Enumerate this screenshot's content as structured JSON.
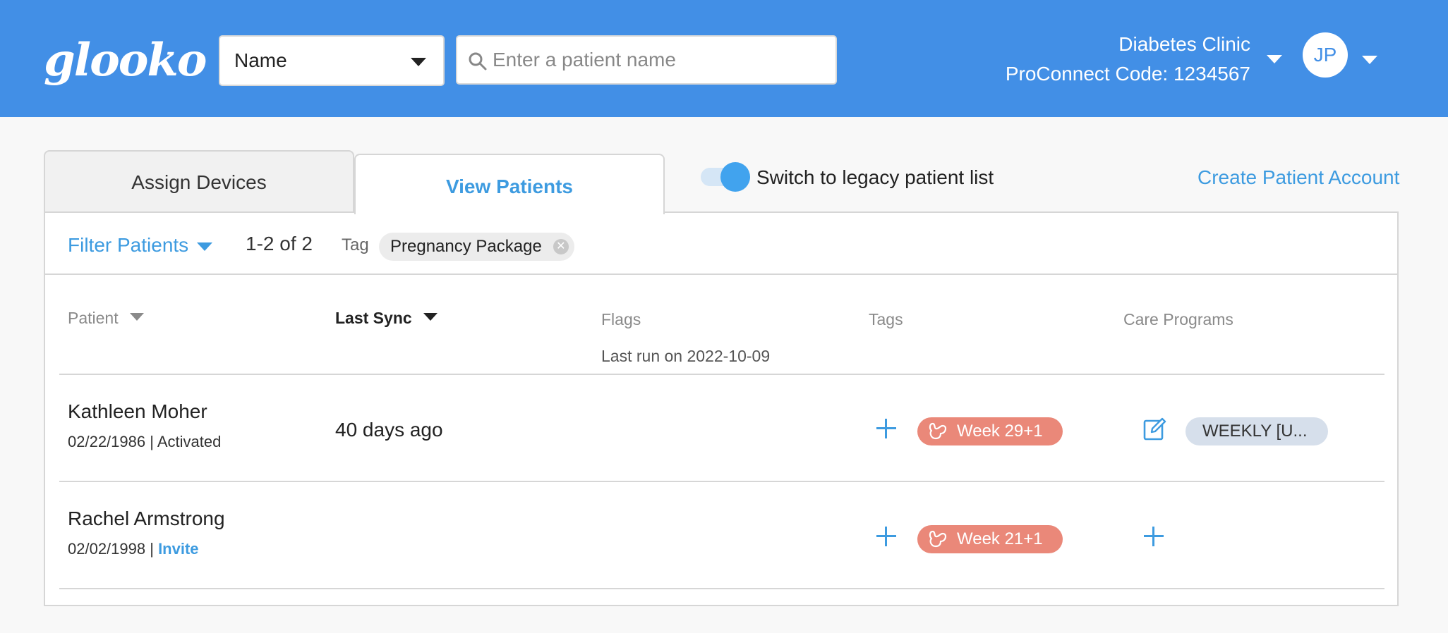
{
  "header": {
    "logo": "glooko",
    "search_type": "Name",
    "search_placeholder": "Enter a patient name",
    "clinic_name": "Diabetes Clinic",
    "proconnect": "ProConnect Code: 1234567",
    "user_initials": "JP"
  },
  "tabs": [
    {
      "label": "Assign Devices",
      "active": false
    },
    {
      "label": "View Patients",
      "active": true
    }
  ],
  "legacy_toggle": {
    "label": "Switch to legacy patient list",
    "on": true
  },
  "create_link": "Create Patient Account",
  "filter": {
    "label": "Filter Patients",
    "count": "1-2 of 2",
    "tag_label": "Tag",
    "tag_chip": "Pregnancy Package"
  },
  "table": {
    "columns": {
      "patient": "Patient",
      "last_sync": "Last Sync",
      "flags": "Flags",
      "tags": "Tags",
      "care_programs": "Care Programs"
    },
    "flags_note": "Last run on 2022-10-09",
    "rows": [
      {
        "name": "Kathleen Moher",
        "dob": "02/22/1986 |",
        "status": "Activated",
        "last_sync": "40 days ago",
        "tag": "Week 29+1",
        "program": "WEEKLY [U..."
      },
      {
        "name": "Rachel Armstrong",
        "dob": "02/02/1998 |",
        "status": "Invite",
        "last_sync": "",
        "tag": "Week 21+1",
        "program": ""
      }
    ]
  },
  "colors": {
    "header_bg": "#428fe6",
    "accent": "#3d9be0",
    "tag_bg": "#ea8879",
    "program_bg": "#d6dfeb"
  }
}
